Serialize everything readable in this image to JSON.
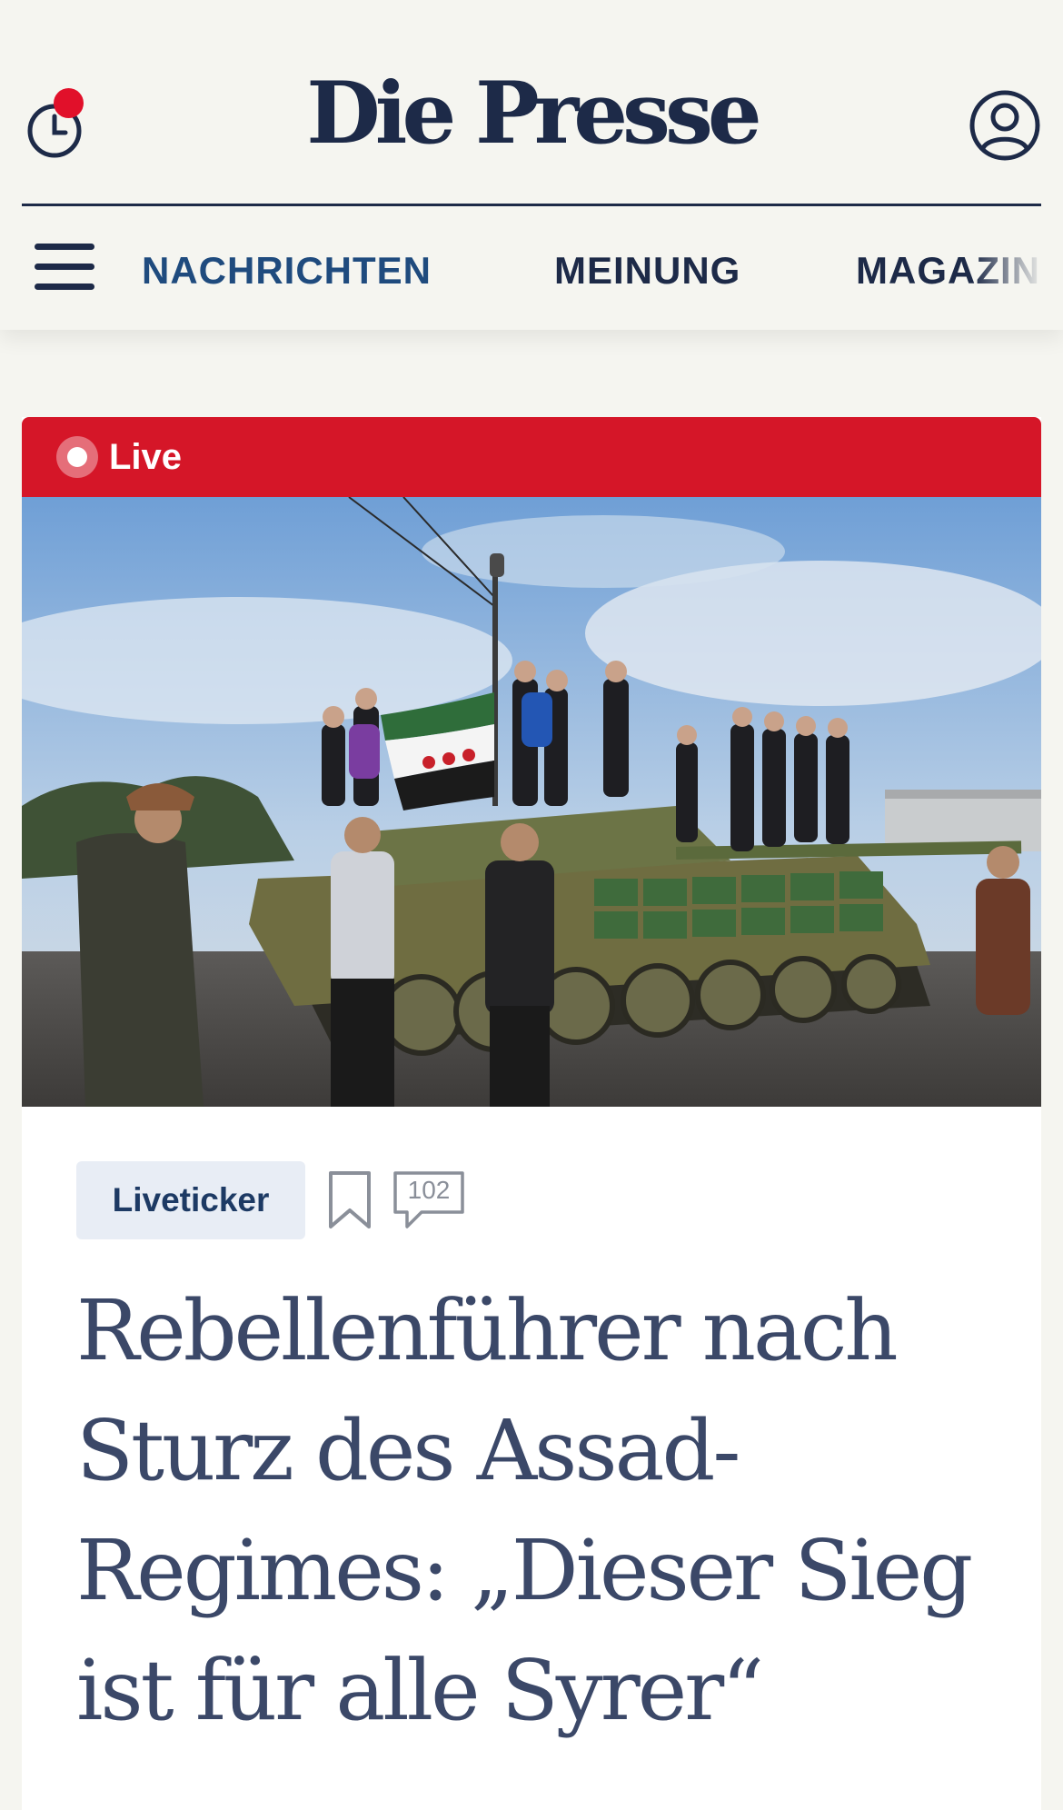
{
  "header": {
    "brand": "Die Presse",
    "history_icon": "clock-history-icon",
    "history_has_notification": true,
    "user_icon": "user-account-icon",
    "menu_icon": "hamburger-menu-icon"
  },
  "nav": {
    "items": [
      {
        "label": "NACHRICHTEN",
        "active": true
      },
      {
        "label": "MEINUNG",
        "active": false
      },
      {
        "label": "MAGAZIN",
        "active": false
      }
    ]
  },
  "article": {
    "live_label": "Live",
    "image_alt": "Menschen feiern auf einem Panzer mit syrischer Oppositionsflagge",
    "tag": "Liveticker",
    "bookmark_icon": "bookmark-icon",
    "comment_icon": "comment-bubble-icon",
    "comment_count": "102",
    "headline": "Rebellenführer nach Sturz des Assad-Regimes: „Dieser Sieg ist für alle Syrer“"
  },
  "colors": {
    "brand_navy": "#1d2a48",
    "nav_active": "#1f4b7e",
    "live_red": "#d51628",
    "notification_red": "#e1102a",
    "tag_bg": "#e8edf5",
    "headline": "#3b4868",
    "page_bg": "#f5f5f0"
  }
}
